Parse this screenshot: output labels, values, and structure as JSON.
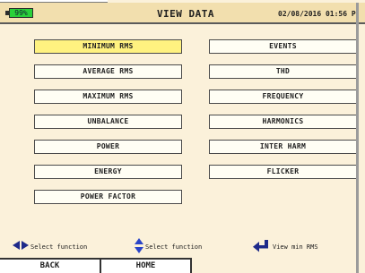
{
  "header": {
    "battery": "99%",
    "title": "VIEW DATA",
    "datetime": "02/08/2016 01:56 P"
  },
  "menu": {
    "left": [
      "MINIMUM RMS",
      "AVERAGE RMS",
      "MAXIMUM RMS",
      "UNBALANCE",
      "POWER",
      "ENERGY",
      "POWER FACTOR"
    ],
    "right": [
      "EVENTS",
      "THD",
      "FREQUENCY",
      "HARMONICS",
      "INTER HARM",
      "FLICKER"
    ],
    "selected": "MINIMUM RMS"
  },
  "hints": {
    "left_right": "Select function",
    "up_down": "Select function",
    "enter": "View min RMS"
  },
  "footer": {
    "back": "BACK",
    "home": "HOME"
  },
  "colors": {
    "background": "#fbf1da",
    "header": "#f2dfae",
    "selected": "#fff280",
    "battery": "#2ad03a",
    "arrow_left_right": "#1e2a8a",
    "arrow_up_down": "#2a44c8",
    "enter_arrow": "#1e2a8a"
  }
}
